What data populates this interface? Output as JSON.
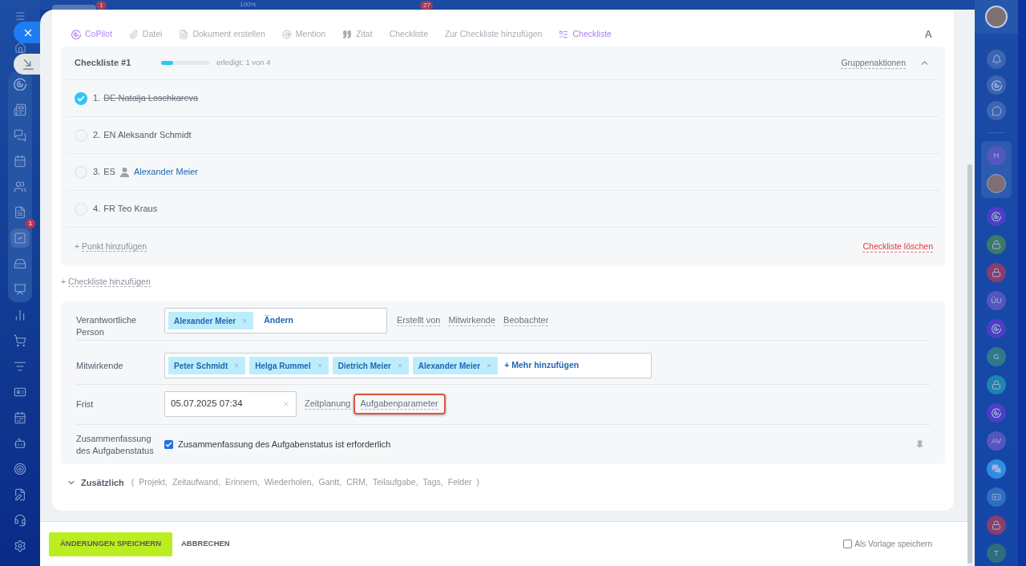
{
  "top_bar": {
    "left_badge": "1",
    "zoom_label": "100%",
    "right_badge": "27"
  },
  "left_sidebar": {
    "pinned": [
      {
        "selected": false
      },
      {
        "selected": false
      },
      {
        "selected": false
      },
      {
        "selected": false
      },
      {
        "selected": false
      },
      {
        "selected": false
      },
      {
        "selected": true,
        "badge": "1"
      },
      {
        "selected": false
      },
      {
        "selected": false
      }
    ],
    "more": [
      {
        "selected": false
      },
      {
        "selected": false
      },
      {
        "selected": false
      },
      {
        "selected": false
      },
      {
        "selected": false
      },
      {
        "selected": false
      },
      {
        "selected": false
      },
      {
        "selected": false
      },
      {
        "selected": false
      },
      {
        "selected": false
      }
    ]
  },
  "toolbar": {
    "items": [
      {
        "kind": "copilot",
        "label": "CoPilot"
      },
      {
        "kind": "file",
        "label": "Datei"
      },
      {
        "kind": "document",
        "label": "Dokument erstellen"
      },
      {
        "kind": "mention",
        "label": "Mention"
      },
      {
        "kind": "quote",
        "label": "Zitat"
      },
      {
        "kind": "plain",
        "label": "Checkliste"
      },
      {
        "kind": "plain",
        "label": "Zur Checkliste hinzufügen"
      },
      {
        "kind": "checklist",
        "label": "Checkliste"
      }
    ],
    "format_toggle": "A"
  },
  "checklist": {
    "title": "Checkliste #1",
    "level": 0.25,
    "progress_text": "erledigt: 1 von 4",
    "group_actions": "Gruppenaktionen",
    "expanded": true,
    "items": [
      {
        "number": "1.",
        "text": "DE Natalja Loschkareva",
        "checked": true
      },
      {
        "number": "2.",
        "text": "EN Aleksandr Schmidt",
        "checked": false
      },
      {
        "number": "3.",
        "text": "ES",
        "mention": "Alexander Meier",
        "checked": false
      },
      {
        "number": "4.",
        "text": "FR Teo Kraus",
        "checked": false
      }
    ],
    "add_plus": "+",
    "add_item": "Punkt hinzufügen",
    "delete": "Checkliste löschen"
  },
  "add_checklist": {
    "plus": "+",
    "label": "Checkliste hinzufügen"
  },
  "form": {
    "responsible": {
      "label": "Verantwortliche Person",
      "tags": [
        "Alexander Meier"
      ],
      "action": "Ändern",
      "links": [
        "Erstellt von",
        "Mitwirkende",
        "Beobachter"
      ]
    },
    "participants": {
      "label": "Mitwirkende",
      "tags": [
        "Peter Schmidt",
        "Helga Rummel",
        "Dietrich Meier",
        "Alexander Meier"
      ],
      "action": "+ Mehr hinzufügen"
    },
    "deadline": {
      "label": "Frist",
      "value": "05.07.2025 07:34",
      "links": [
        {
          "label": "Zeitplanung",
          "highlighted": false
        },
        {
          "label": "Aufgabenparameter",
          "highlighted": true
        }
      ]
    },
    "status_summary": {
      "label": "Zusammenfassung des Aufgabenstatus",
      "checked": true,
      "text": "Zusammenfassung des Aufgabenstatus ist erforderlich"
    }
  },
  "additional": {
    "label": "Zusätzlich",
    "expanded": false,
    "open": "(",
    "items": [
      "Projekt,",
      "Zeitaufwand,",
      "Erinnern,",
      "Wiederholen,",
      "Gantt,",
      "CRM,",
      "Teilaufgabe,",
      "Tags,",
      "Felder"
    ],
    "close": ")"
  },
  "footer": {
    "save": "ÄNDERUNGEN SPEICHERN",
    "cancel": "ABBRECHEN",
    "template": {
      "label": "Als Vorlage speichern",
      "checked": false
    }
  },
  "right_sidebar": {
    "profile": {
      "kind": "avatar"
    },
    "tools": [
      {
        "kind": "bell"
      },
      {
        "kind": "copilot"
      },
      {
        "kind": "chat-sync"
      }
    ],
    "pinned": [
      {
        "kind": "initials",
        "text": "H",
        "color": "#5557bf"
      },
      {
        "kind": "avatar"
      }
    ],
    "chats": [
      {
        "kind": "copilot",
        "color": "#4c3ec6"
      },
      {
        "kind": "lock",
        "color": "#3c7a66"
      },
      {
        "kind": "lock",
        "color": "#8a3e6a"
      },
      {
        "kind": "initials",
        "text": "ÜU",
        "color": "#5556bd"
      },
      {
        "kind": "copilot",
        "color": "#4c3ec6"
      },
      {
        "kind": "initials",
        "text": "G",
        "color": "#2f7a8a"
      },
      {
        "kind": "lock",
        "color": "#1f84ad"
      },
      {
        "kind": "copilot",
        "color": "#4c3ec6"
      },
      {
        "kind": "initials",
        "text": "AV",
        "color": "#5556bd"
      },
      {
        "kind": "messages",
        "color": "#2f8ee2"
      },
      {
        "kind": "contact-card",
        "color": "#2c6ec0"
      },
      {
        "kind": "lock",
        "color": "#8a3e6a"
      },
      {
        "kind": "initials",
        "text": "T",
        "color": "#2d6d7e"
      }
    ]
  }
}
